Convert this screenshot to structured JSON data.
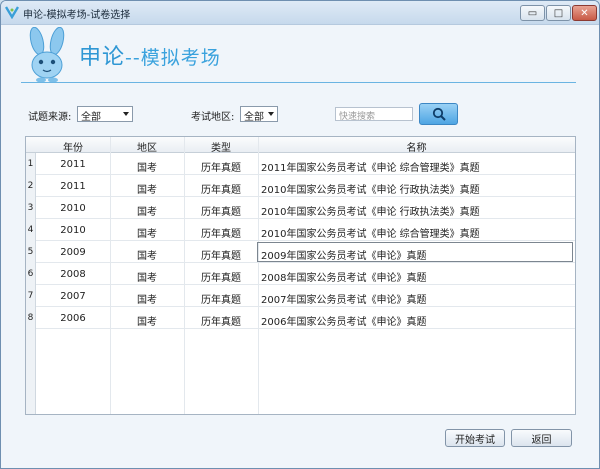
{
  "window": {
    "title": "申论-模拟考场-试卷选择",
    "min_label": "▭",
    "max_label": "□",
    "close_label": "✕"
  },
  "header": {
    "app_name": "申论",
    "app_sub": "--模拟考场"
  },
  "filters": {
    "source_label": "试题来源:",
    "source_value": "全部",
    "region_label": "考试地区:",
    "region_value": "全部",
    "search_placeholder": "快速搜索"
  },
  "table": {
    "columns": [
      "年份",
      "地区",
      "类型",
      "名称"
    ],
    "rows": [
      {
        "num": "1",
        "year": "2011",
        "region": "国考",
        "type": "历年真题",
        "name": "2011年国家公务员考试《申论 综合管理类》真题"
      },
      {
        "num": "2",
        "year": "2011",
        "region": "国考",
        "type": "历年真题",
        "name": "2010年国家公务员考试《申论 行政执法类》真题"
      },
      {
        "num": "3",
        "year": "2010",
        "region": "国考",
        "type": "历年真题",
        "name": "2010年国家公务员考试《申论 行政执法类》真题"
      },
      {
        "num": "4",
        "year": "2010",
        "region": "国考",
        "type": "历年真题",
        "name": "2010年国家公务员考试《申论 综合管理类》真题"
      },
      {
        "num": "5",
        "year": "2009",
        "region": "国考",
        "type": "历年真题",
        "name": "2009年国家公务员考试《申论》真题"
      },
      {
        "num": "6",
        "year": "2008",
        "region": "国考",
        "type": "历年真题",
        "name": "2008年国家公务员考试《申论》真题"
      },
      {
        "num": "7",
        "year": "2007",
        "region": "国考",
        "type": "历年真题",
        "name": "2007年国家公务员考试《申论》真题"
      },
      {
        "num": "8",
        "year": "2006",
        "region": "国考",
        "type": "历年真题",
        "name": "2006年国家公务员考试《申论》真题"
      }
    ]
  },
  "buttons": {
    "start": "开始考试",
    "back": "返回"
  },
  "colors": {
    "accent": "#2f97d4",
    "header_line": "#6ab4e2"
  }
}
